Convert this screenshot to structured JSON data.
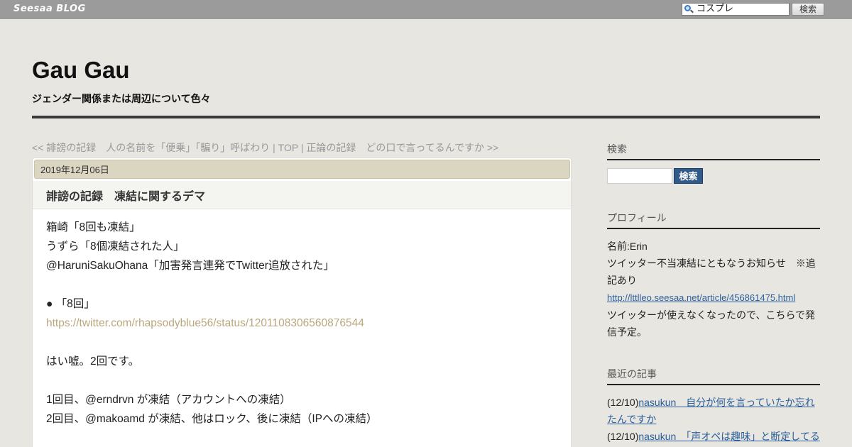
{
  "topbar": {
    "brand": "Seesaa BLOG",
    "search_value": "コスプレ",
    "search_button": "検索"
  },
  "header": {
    "title": "Gau Gau",
    "description": "ジェンダー関係または周辺について色々"
  },
  "nav": {
    "prev": "<< 誹謗の記録　人の名前を「便乗」「騙り」呼ばわり",
    "sep1": " | ",
    "top": "TOP",
    "sep2": " | ",
    "next": "正論の記録　どの口で言ってるんですか >>"
  },
  "article": {
    "date": "2019年12月06日",
    "title": "誹謗の記録　凍結に関するデマ",
    "lines": [
      "箱崎「8回も凍結」",
      "うずら「8個凍結された人」",
      "@HaruniSakuOhana「加害発言連発でTwitter追放された」",
      "",
      "● 「8回」",
      "https://twitter.com/rhapsodyblue56/status/1201108306560876544",
      "",
      "はい嘘。2回です。",
      "",
      "1回目、@erndrvn が凍結（アカウントへの凍結）",
      "2回目、@makoamd が凍結、他はロック、後に凍結（IPへの凍結）"
    ]
  },
  "sidebar": {
    "search_heading": "検索",
    "search_button": "検索",
    "profile_heading": "プロフィール",
    "profile_name": "名前:Erin",
    "profile_text1": "ツイッター不当凍結にともなうお知らせ　※追記あり",
    "profile_link": "http://lttlleo.seesaa.net/article/456861475.html",
    "profile_text2": "ツイッターが使えなくなったので、こちらで発信予定。",
    "recent_heading": "最近の記事",
    "recent": [
      {
        "date": "(12/10)",
        "title": "nasukun　自分が何を言っていたか忘れたんですか"
      },
      {
        "date": "(12/10)",
        "title": "nasukun　「声オペは趣味」と断定してることわかってる？　★さらに追記"
      }
    ]
  },
  "colors": {
    "topbar": "#9b9b9b",
    "page_bg": "#e8e6e1",
    "date_bar": "#dbd6c1",
    "link": "#2b5e9a",
    "body_link": "#b9a77e",
    "sidebar_button": "#2f5a8a"
  }
}
